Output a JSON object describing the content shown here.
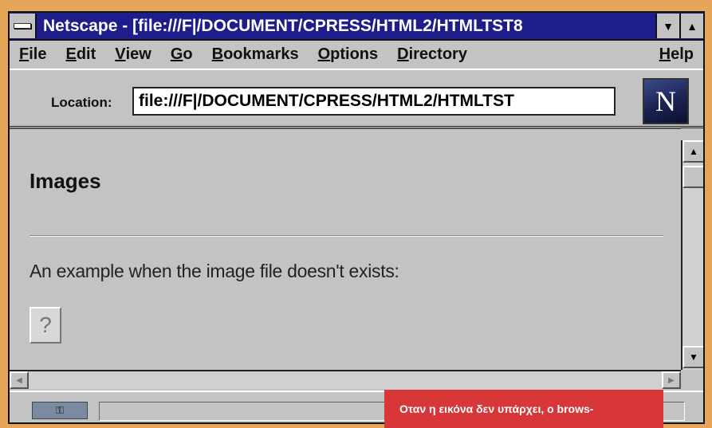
{
  "window": {
    "title": "Netscape - [file:///F|/DOCUMENT/CPRESS/HTML2/HTMLTST8"
  },
  "menu": {
    "items": [
      {
        "accel": "F",
        "rest": "ile"
      },
      {
        "accel": "E",
        "rest": "dit"
      },
      {
        "accel": "V",
        "rest": "iew"
      },
      {
        "accel": "G",
        "rest": "o"
      },
      {
        "accel": "B",
        "rest": "ookmarks"
      },
      {
        "accel": "O",
        "rest": "ptions"
      },
      {
        "accel": "D",
        "rest": "irectory"
      },
      {
        "accel": "H",
        "rest": "elp"
      }
    ]
  },
  "location": {
    "label": "Location:",
    "value": "file:///F|/DOCUMENT/CPRESS/HTML2/HTMLTST"
  },
  "logo": {
    "letter": "N"
  },
  "page": {
    "heading": "Images",
    "paragraph": "An example when the image file doesn't exists:",
    "broken_image_glyph": "?"
  },
  "caption": {
    "text": "Οταν η εικόνα δεν υπάρχει, ο brows-"
  },
  "icons": {
    "system_menu": "system-menu-icon",
    "minimize": "minimize-icon",
    "maximize": "maximize-icon",
    "scroll_up": "arrow-up-icon",
    "scroll_down": "arrow-down-icon",
    "scroll_left": "arrow-left-icon",
    "scroll_right": "arrow-right-icon",
    "security": "security-key-icon",
    "broken_image": "broken-image-icon"
  }
}
